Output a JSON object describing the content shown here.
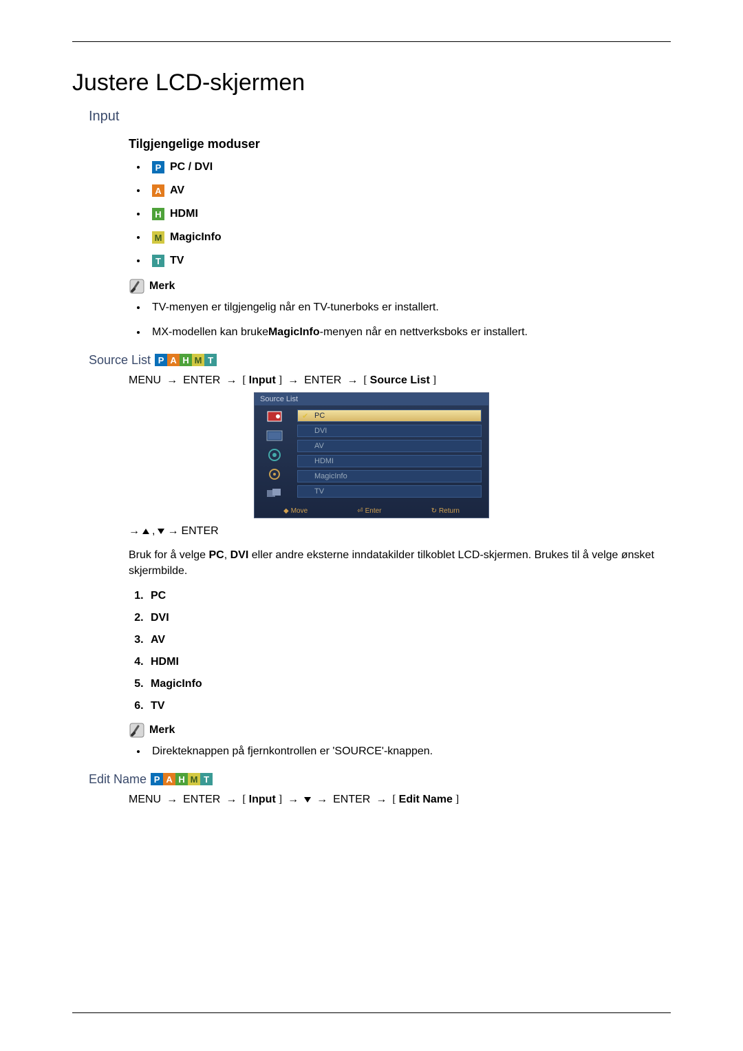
{
  "title": "Justere LCD-skjermen",
  "sections": {
    "input": {
      "heading": "Input",
      "modes_heading": "Tilgjengelige moduser",
      "modes": {
        "p": {
          "letter": "P",
          "label": "PC / DVI"
        },
        "a": {
          "letter": "A",
          "label": "AV"
        },
        "h": {
          "letter": "H",
          "label": "HDMI"
        },
        "m": {
          "letter": "M",
          "label": "MagicInfo"
        },
        "t": {
          "letter": "T",
          "label": "TV"
        }
      },
      "note_label": "Merk",
      "notes": [
        {
          "pre": "TV-menyen er tilgjengelig når en TV-tunerboks er installert.",
          "bold": "",
          "post": ""
        },
        {
          "pre": "MX-modellen kan bruke",
          "bold": "MagicInfo",
          "post": "-menyen når en nettverksboks er installert."
        }
      ]
    },
    "source_list": {
      "heading": "Source List",
      "nav": {
        "menu": "MENU",
        "enter": "ENTER",
        "input": "Input",
        "target": "Source List"
      },
      "osd": {
        "title": "Source List",
        "items": [
          "PC",
          "DVI",
          "AV",
          "HDMI",
          "MagicInfo",
          "TV"
        ],
        "footer": {
          "move": "Move",
          "enter": "Enter",
          "return": "Return"
        }
      },
      "post_nav_enter": "ENTER",
      "para_pre": "Bruk for å velge ",
      "para_b1": "PC",
      "para_mid1": ", ",
      "para_b2": "DVI",
      "para_mid2": " eller andre eksterne inndatakilder tilkoblet LCD-skjermen. Brukes til å velge ønsket skjermbilde.",
      "numbered": [
        "PC",
        "DVI",
        "AV",
        "HDMI",
        "MagicInfo",
        "TV"
      ],
      "note_label": "Merk",
      "note_bullet": "Direkteknappen på fjernkontrollen er 'SOURCE'-knappen."
    },
    "edit_name": {
      "heading": "Edit Name",
      "nav": {
        "menu": "MENU",
        "enter": "ENTER",
        "input": "Input",
        "target": "Edit Name"
      }
    }
  }
}
